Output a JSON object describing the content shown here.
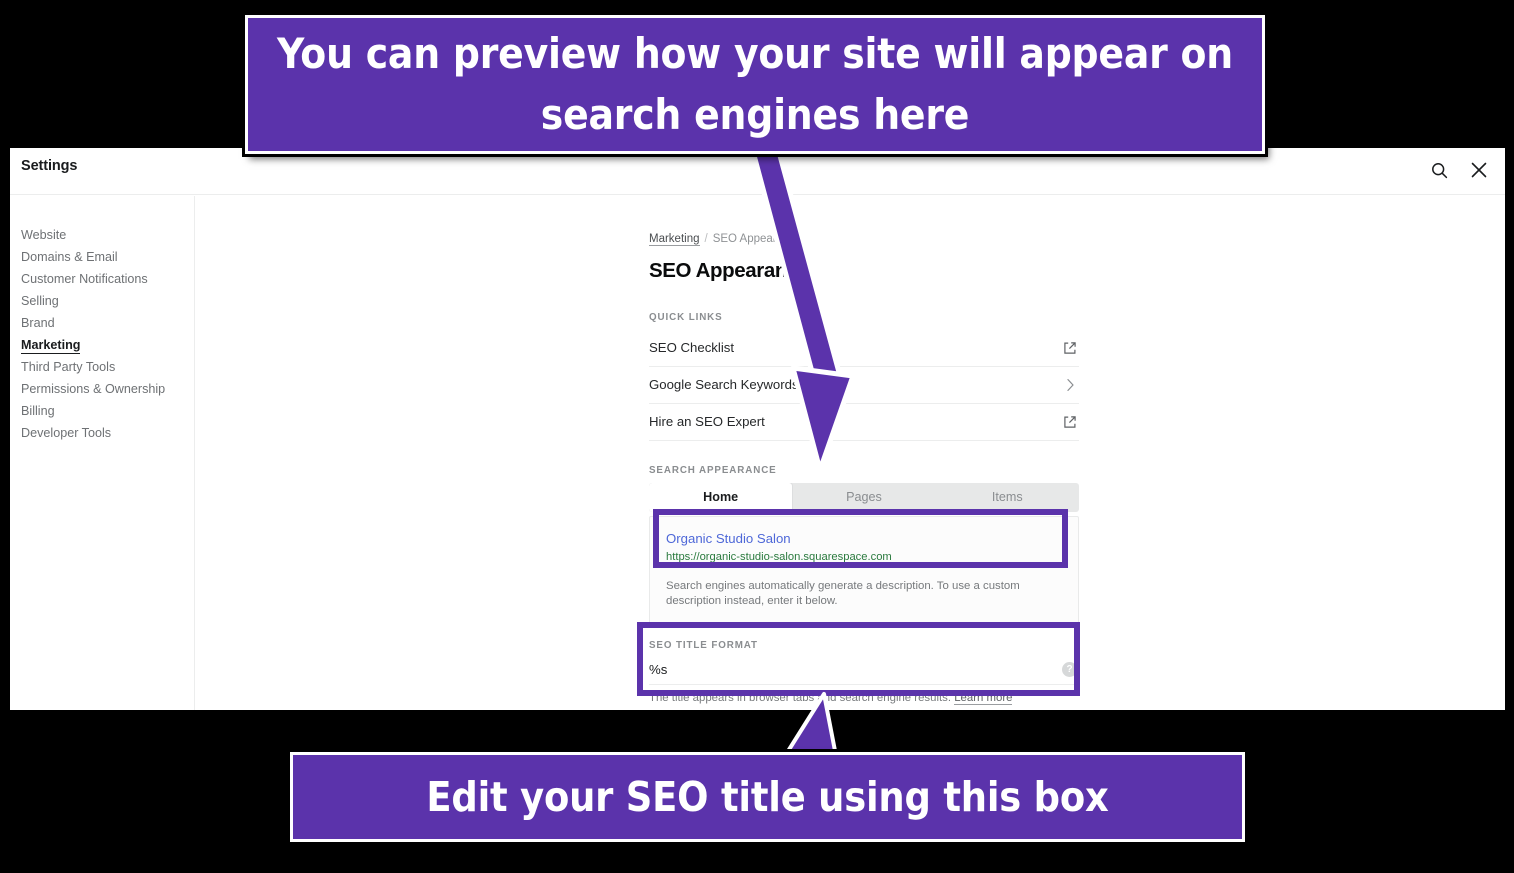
{
  "window": {
    "title": "Settings",
    "search_icon": "search-icon",
    "close_icon": "close-icon"
  },
  "sidebar": {
    "items": [
      {
        "label": "Website",
        "active": false
      },
      {
        "label": "Domains & Email",
        "active": false
      },
      {
        "label": "Customer Notifications",
        "active": false
      },
      {
        "label": "Selling",
        "active": false
      },
      {
        "label": "Brand",
        "active": false
      },
      {
        "label": "Marketing",
        "active": true
      },
      {
        "label": "Third Party Tools",
        "active": false
      },
      {
        "label": "Permissions & Ownership",
        "active": false
      },
      {
        "label": "Billing",
        "active": false
      },
      {
        "label": "Developer Tools",
        "active": false
      }
    ]
  },
  "main": {
    "breadcrumb": {
      "parent": "Marketing",
      "separator": "/",
      "current": "SEO Appearance"
    },
    "page_title": "SEO Appearance",
    "quick_links": {
      "label": "Quick Links",
      "rows": [
        {
          "label": "SEO Checklist",
          "icon": "external-link-icon"
        },
        {
          "label": "Google Search Keywords",
          "icon": "chevron-right-icon"
        },
        {
          "label": "Hire an SEO Expert",
          "icon": "external-link-icon"
        }
      ]
    },
    "search_appearance": {
      "label": "Search Appearance",
      "tabs": [
        {
          "label": "Home",
          "active": true
        },
        {
          "label": "Pages",
          "active": false
        },
        {
          "label": "Items",
          "active": false
        }
      ],
      "preview": {
        "title": "Organic Studio Salon",
        "url": "https://organic-studio-salon.squarespace.com",
        "description": "Search engines automatically generate a description. To use a custom description instead, enter it below."
      },
      "seo_title_format": {
        "label": "SEO Title Format",
        "value": "%s",
        "help_icon": "question-mark-icon",
        "help_text": "The title appears in browser tabs and search engine results.",
        "help_link": "Learn more"
      }
    }
  },
  "annotations": {
    "accent_color": "#5b33ab",
    "callout_top": "You can preview how your site will appear on search engines here",
    "callout_bottom": "Edit your SEO title using this box",
    "highlight_preview_target": "search-preview-card",
    "highlight_seo_title_target": "seo-title-format-field"
  }
}
